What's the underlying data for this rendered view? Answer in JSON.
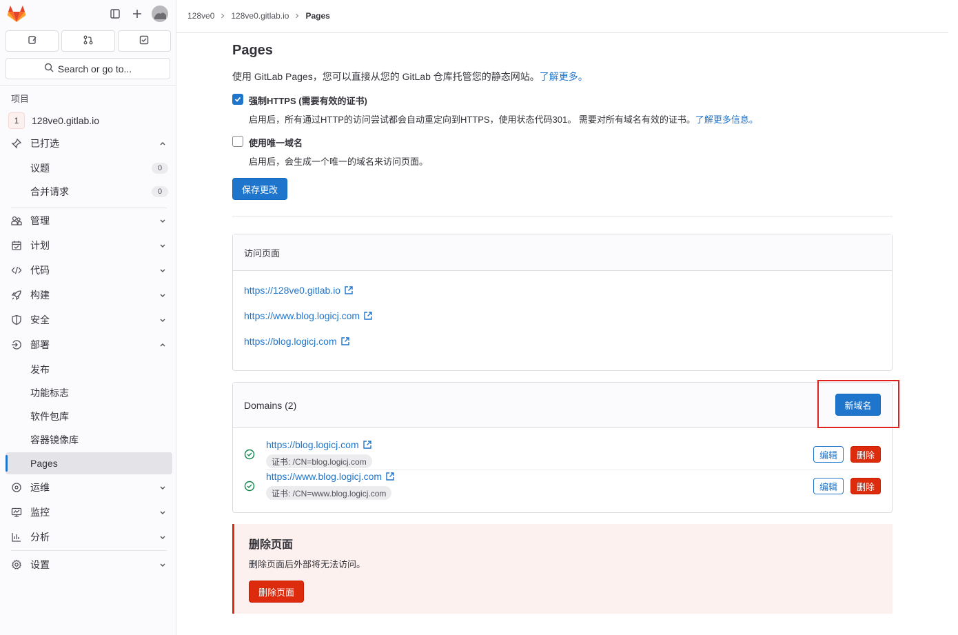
{
  "sidebar": {
    "search_label": "Search or go to...",
    "section_label": "项目",
    "project_badge": "1",
    "project_name": "128ve0.gitlab.io",
    "pinned": {
      "label": "已打选",
      "items": [
        {
          "label": "议题",
          "count": "0"
        },
        {
          "label": "合并请求",
          "count": "0"
        }
      ]
    },
    "nav": [
      {
        "label": "管理",
        "icon": "users-icon"
      },
      {
        "label": "计划",
        "icon": "calendar-icon"
      },
      {
        "label": "代码",
        "icon": "code-icon"
      },
      {
        "label": "构建",
        "icon": "rocket-icon"
      },
      {
        "label": "安全",
        "icon": "shield-icon"
      }
    ],
    "deploy": {
      "label": "部署",
      "items": [
        "发布",
        "功能标志",
        "软件包库",
        "容器镜像库",
        "Pages"
      ]
    },
    "nav2": [
      {
        "label": "运维",
        "icon": "monitor-icon"
      },
      {
        "label": "监控",
        "icon": "screen-icon"
      },
      {
        "label": "分析",
        "icon": "chart-icon"
      }
    ],
    "settings": "设置"
  },
  "breadcrumb": {
    "items": [
      "128ve0",
      "128ve0.gitlab.io"
    ],
    "current": "Pages"
  },
  "page": {
    "title": "Pages",
    "description": "使用 GitLab Pages，您可以直接从您的 GitLab 仓库托管您的静态网站。",
    "learn_more": "了解更多。",
    "https_label": "强制HTTPS (需要有效的证书)",
    "https_help": "启用后，所有通过HTTP的访问尝试都会自动重定向到HTTPS，使用状态代码301。 需要对所有域名有效的证书。",
    "https_more": "了解更多信息。",
    "https_checked": true,
    "unique_label": "使用唯一域名",
    "unique_help": "启用后，会生成一个唯一的域名来访问页面。",
    "unique_checked": false,
    "save_button": "保存更改"
  },
  "visit": {
    "header": "访问页面",
    "links": [
      "https://128ve0.gitlab.io",
      "https://www.blog.logicj.com",
      "https://blog.logicj.com"
    ]
  },
  "domains": {
    "header": "Domains (2)",
    "new_button": "新域名",
    "edit_label": "编辑",
    "delete_label": "删除",
    "rows": [
      {
        "url": "https://blog.logicj.com",
        "cert": "证书: /CN=blog.logicj.com"
      },
      {
        "url": "https://www.blog.logicj.com",
        "cert": "证书: /CN=www.blog.logicj.com"
      }
    ]
  },
  "danger": {
    "title": "删除页面",
    "text": "删除页面后外部将无法访问。",
    "button": "删除页面"
  }
}
